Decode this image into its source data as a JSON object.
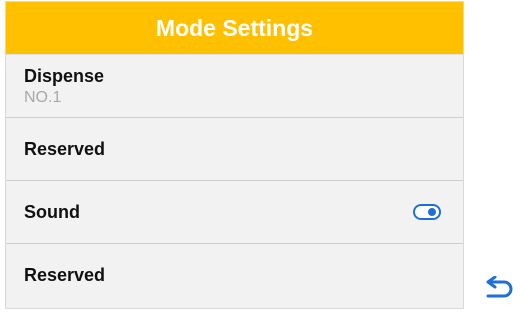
{
  "header": {
    "title": "Mode Settings"
  },
  "rows": [
    {
      "label": "Dispense",
      "sub": "NO.1"
    },
    {
      "label": "Reserved"
    },
    {
      "label": "Sound",
      "toggle_on": true
    },
    {
      "label": "Reserved"
    }
  ],
  "icons": {
    "back": "back-arrow-icon",
    "toggle": "toggle-switch-icon"
  },
  "colors": {
    "header_bg": "#ffc000",
    "accent": "#1f6fd6",
    "panel_bg": "#f2f2f2"
  }
}
